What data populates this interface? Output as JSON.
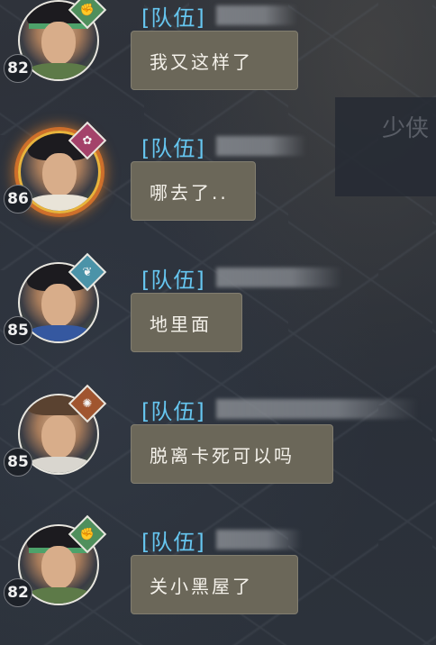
{
  "messages": [
    {
      "channel_tag": "[队伍]",
      "level": "82",
      "text": "我又这样了",
      "badge_color": "#4f8f5c",
      "badge_icon": "fist-icon"
    },
    {
      "channel_tag": "[队伍]",
      "level": "86",
      "text": "哪去了..",
      "badge_color": "#a4426a",
      "badge_icon": "flame-icon"
    },
    {
      "channel_tag": "[队伍]",
      "level": "85",
      "text": "地里面",
      "badge_color": "#4b93a8",
      "badge_icon": "leaf-icon"
    },
    {
      "channel_tag": "[队伍]",
      "level": "85",
      "text": "脱离卡死可以吗",
      "badge_color": "#a0552f",
      "badge_icon": "sun-icon"
    },
    {
      "channel_tag": "[队伍]",
      "level": "82",
      "text": "关小黑屋了",
      "badge_color": "#4f8f5c",
      "badge_icon": "fist-icon"
    }
  ],
  "background_text": "少侠",
  "colors": {
    "tag": "#66c6f0",
    "bubble": "#6b6759",
    "background": "#2b3039"
  }
}
